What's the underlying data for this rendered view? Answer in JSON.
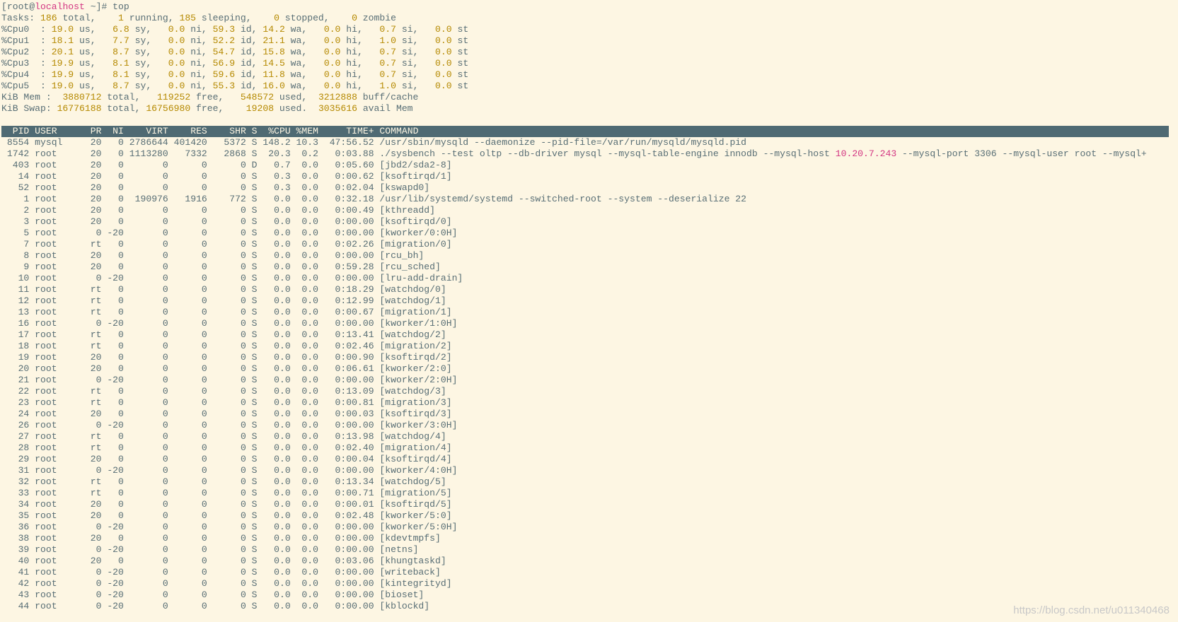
{
  "prompt": {
    "user": "root",
    "at": "@",
    "host": "localhost",
    "rest": " ~]# ",
    "command": "top",
    "open": "["
  },
  "tasks": {
    "label": "Tasks: ",
    "total": "186",
    "running": "1",
    "sleeping": "185",
    "stopped": "0",
    "zombie": "0"
  },
  "cpus": [
    {
      "name": "%Cpu0",
      "us": "19.0",
      "sy": "6.8",
      "ni": "0.0",
      "id": "59.3",
      "wa": "14.2",
      "hi": "0.0",
      "si": "0.7",
      "st": "0.0"
    },
    {
      "name": "%Cpu1",
      "us": "18.1",
      "sy": "7.7",
      "ni": "0.0",
      "id": "52.2",
      "wa": "21.1",
      "hi": "0.0",
      "si": "1.0",
      "st": "0.0"
    },
    {
      "name": "%Cpu2",
      "us": "20.1",
      "sy": "8.7",
      "ni": "0.0",
      "id": "54.7",
      "wa": "15.8",
      "hi": "0.0",
      "si": "0.7",
      "st": "0.0"
    },
    {
      "name": "%Cpu3",
      "us": "19.9",
      "sy": "8.1",
      "ni": "0.0",
      "id": "56.9",
      "wa": "14.5",
      "hi": "0.0",
      "si": "0.7",
      "st": "0.0"
    },
    {
      "name": "%Cpu4",
      "us": "19.9",
      "sy": "8.1",
      "ni": "0.0",
      "id": "59.6",
      "wa": "11.8",
      "hi": "0.0",
      "si": "0.7",
      "st": "0.0"
    },
    {
      "name": "%Cpu5",
      "us": "19.0",
      "sy": "8.7",
      "ni": "0.0",
      "id": "55.3",
      "wa": "16.0",
      "hi": "0.0",
      "si": "1.0",
      "st": "0.0"
    }
  ],
  "mem": {
    "label": "KiB Mem : ",
    "total": "3880712",
    "free": "119252",
    "used": "548572",
    "buff": "3212888"
  },
  "swap": {
    "label": "KiB Swap: ",
    "total": "16776188",
    "free": "16756980",
    "used": "19208",
    "avail": "3035616"
  },
  "columns": [
    "PID",
    "USER",
    "PR",
    "NI",
    "VIRT",
    "RES",
    "SHR",
    "S",
    "%CPU",
    "%MEM",
    "TIME+",
    "COMMAND"
  ],
  "processes": [
    {
      "pid": "8554",
      "user": "mysql",
      "pr": "20",
      "ni": "0",
      "virt": "2786644",
      "res": "401420",
      "shr": "5372",
      "s": "S",
      "cpu": "148.2",
      "mem": "10.3",
      "time": "47:56.52",
      "cmd": "/usr/sbin/mysqld --daemonize --pid-file=/var/run/mysqld/mysqld.pid"
    },
    {
      "pid": "1742",
      "user": "root",
      "pr": "20",
      "ni": "0",
      "virt": "1113280",
      "res": "7332",
      "shr": "2868",
      "s": "S",
      "cpu": "20.3",
      "mem": "0.2",
      "time": "0:03.88",
      "cmd": "./sysbench --test oltp --db-driver mysql --mysql-table-engine innodb --mysql-host ",
      "cmd_ip": "10.20.7.243",
      "cmd_tail": " --mysql-port 3306 --mysql-user root --mysql+"
    },
    {
      "pid": "403",
      "user": "root",
      "pr": "20",
      "ni": "0",
      "virt": "0",
      "res": "0",
      "shr": "0",
      "s": "D",
      "cpu": "0.7",
      "mem": "0.0",
      "time": "0:05.60",
      "cmd": "[jbd2/sda2-8]"
    },
    {
      "pid": "14",
      "user": "root",
      "pr": "20",
      "ni": "0",
      "virt": "0",
      "res": "0",
      "shr": "0",
      "s": "S",
      "cpu": "0.3",
      "mem": "0.0",
      "time": "0:00.62",
      "cmd": "[ksoftirqd/1]"
    },
    {
      "pid": "52",
      "user": "root",
      "pr": "20",
      "ni": "0",
      "virt": "0",
      "res": "0",
      "shr": "0",
      "s": "S",
      "cpu": "0.3",
      "mem": "0.0",
      "time": "0:02.04",
      "cmd": "[kswapd0]"
    },
    {
      "pid": "1",
      "user": "root",
      "pr": "20",
      "ni": "0",
      "virt": "190976",
      "res": "1916",
      "shr": "772",
      "s": "S",
      "cpu": "0.0",
      "mem": "0.0",
      "time": "0:32.18",
      "cmd": "/usr/lib/systemd/systemd --switched-root --system --deserialize 22"
    },
    {
      "pid": "2",
      "user": "root",
      "pr": "20",
      "ni": "0",
      "virt": "0",
      "res": "0",
      "shr": "0",
      "s": "S",
      "cpu": "0.0",
      "mem": "0.0",
      "time": "0:00.49",
      "cmd": "[kthreadd]"
    },
    {
      "pid": "3",
      "user": "root",
      "pr": "20",
      "ni": "0",
      "virt": "0",
      "res": "0",
      "shr": "0",
      "s": "S",
      "cpu": "0.0",
      "mem": "0.0",
      "time": "0:00.00",
      "cmd": "[ksoftirqd/0]"
    },
    {
      "pid": "5",
      "user": "root",
      "pr": "0",
      "ni": "-20",
      "virt": "0",
      "res": "0",
      "shr": "0",
      "s": "S",
      "cpu": "0.0",
      "mem": "0.0",
      "time": "0:00.00",
      "cmd": "[kworker/0:0H]"
    },
    {
      "pid": "7",
      "user": "root",
      "pr": "rt",
      "ni": "0",
      "virt": "0",
      "res": "0",
      "shr": "0",
      "s": "S",
      "cpu": "0.0",
      "mem": "0.0",
      "time": "0:02.26",
      "cmd": "[migration/0]"
    },
    {
      "pid": "8",
      "user": "root",
      "pr": "20",
      "ni": "0",
      "virt": "0",
      "res": "0",
      "shr": "0",
      "s": "S",
      "cpu": "0.0",
      "mem": "0.0",
      "time": "0:00.00",
      "cmd": "[rcu_bh]"
    },
    {
      "pid": "9",
      "user": "root",
      "pr": "20",
      "ni": "0",
      "virt": "0",
      "res": "0",
      "shr": "0",
      "s": "S",
      "cpu": "0.0",
      "mem": "0.0",
      "time": "0:59.28",
      "cmd": "[rcu_sched]"
    },
    {
      "pid": "10",
      "user": "root",
      "pr": "0",
      "ni": "-20",
      "virt": "0",
      "res": "0",
      "shr": "0",
      "s": "S",
      "cpu": "0.0",
      "mem": "0.0",
      "time": "0:00.00",
      "cmd": "[lru-add-drain]"
    },
    {
      "pid": "11",
      "user": "root",
      "pr": "rt",
      "ni": "0",
      "virt": "0",
      "res": "0",
      "shr": "0",
      "s": "S",
      "cpu": "0.0",
      "mem": "0.0",
      "time": "0:18.29",
      "cmd": "[watchdog/0]"
    },
    {
      "pid": "12",
      "user": "root",
      "pr": "rt",
      "ni": "0",
      "virt": "0",
      "res": "0",
      "shr": "0",
      "s": "S",
      "cpu": "0.0",
      "mem": "0.0",
      "time": "0:12.99",
      "cmd": "[watchdog/1]"
    },
    {
      "pid": "13",
      "user": "root",
      "pr": "rt",
      "ni": "0",
      "virt": "0",
      "res": "0",
      "shr": "0",
      "s": "S",
      "cpu": "0.0",
      "mem": "0.0",
      "time": "0:00.67",
      "cmd": "[migration/1]"
    },
    {
      "pid": "16",
      "user": "root",
      "pr": "0",
      "ni": "-20",
      "virt": "0",
      "res": "0",
      "shr": "0",
      "s": "S",
      "cpu": "0.0",
      "mem": "0.0",
      "time": "0:00.00",
      "cmd": "[kworker/1:0H]"
    },
    {
      "pid": "17",
      "user": "root",
      "pr": "rt",
      "ni": "0",
      "virt": "0",
      "res": "0",
      "shr": "0",
      "s": "S",
      "cpu": "0.0",
      "mem": "0.0",
      "time": "0:13.41",
      "cmd": "[watchdog/2]"
    },
    {
      "pid": "18",
      "user": "root",
      "pr": "rt",
      "ni": "0",
      "virt": "0",
      "res": "0",
      "shr": "0",
      "s": "S",
      "cpu": "0.0",
      "mem": "0.0",
      "time": "0:02.46",
      "cmd": "[migration/2]"
    },
    {
      "pid": "19",
      "user": "root",
      "pr": "20",
      "ni": "0",
      "virt": "0",
      "res": "0",
      "shr": "0",
      "s": "S",
      "cpu": "0.0",
      "mem": "0.0",
      "time": "0:00.90",
      "cmd": "[ksoftirqd/2]"
    },
    {
      "pid": "20",
      "user": "root",
      "pr": "20",
      "ni": "0",
      "virt": "0",
      "res": "0",
      "shr": "0",
      "s": "S",
      "cpu": "0.0",
      "mem": "0.0",
      "time": "0:06.61",
      "cmd": "[kworker/2:0]"
    },
    {
      "pid": "21",
      "user": "root",
      "pr": "0",
      "ni": "-20",
      "virt": "0",
      "res": "0",
      "shr": "0",
      "s": "S",
      "cpu": "0.0",
      "mem": "0.0",
      "time": "0:00.00",
      "cmd": "[kworker/2:0H]"
    },
    {
      "pid": "22",
      "user": "root",
      "pr": "rt",
      "ni": "0",
      "virt": "0",
      "res": "0",
      "shr": "0",
      "s": "S",
      "cpu": "0.0",
      "mem": "0.0",
      "time": "0:13.09",
      "cmd": "[watchdog/3]"
    },
    {
      "pid": "23",
      "user": "root",
      "pr": "rt",
      "ni": "0",
      "virt": "0",
      "res": "0",
      "shr": "0",
      "s": "S",
      "cpu": "0.0",
      "mem": "0.0",
      "time": "0:00.81",
      "cmd": "[migration/3]"
    },
    {
      "pid": "24",
      "user": "root",
      "pr": "20",
      "ni": "0",
      "virt": "0",
      "res": "0",
      "shr": "0",
      "s": "S",
      "cpu": "0.0",
      "mem": "0.0",
      "time": "0:00.03",
      "cmd": "[ksoftirqd/3]"
    },
    {
      "pid": "26",
      "user": "root",
      "pr": "0",
      "ni": "-20",
      "virt": "0",
      "res": "0",
      "shr": "0",
      "s": "S",
      "cpu": "0.0",
      "mem": "0.0",
      "time": "0:00.00",
      "cmd": "[kworker/3:0H]"
    },
    {
      "pid": "27",
      "user": "root",
      "pr": "rt",
      "ni": "0",
      "virt": "0",
      "res": "0",
      "shr": "0",
      "s": "S",
      "cpu": "0.0",
      "mem": "0.0",
      "time": "0:13.98",
      "cmd": "[watchdog/4]"
    },
    {
      "pid": "28",
      "user": "root",
      "pr": "rt",
      "ni": "0",
      "virt": "0",
      "res": "0",
      "shr": "0",
      "s": "S",
      "cpu": "0.0",
      "mem": "0.0",
      "time": "0:02.40",
      "cmd": "[migration/4]"
    },
    {
      "pid": "29",
      "user": "root",
      "pr": "20",
      "ni": "0",
      "virt": "0",
      "res": "0",
      "shr": "0",
      "s": "S",
      "cpu": "0.0",
      "mem": "0.0",
      "time": "0:00.04",
      "cmd": "[ksoftirqd/4]"
    },
    {
      "pid": "31",
      "user": "root",
      "pr": "0",
      "ni": "-20",
      "virt": "0",
      "res": "0",
      "shr": "0",
      "s": "S",
      "cpu": "0.0",
      "mem": "0.0",
      "time": "0:00.00",
      "cmd": "[kworker/4:0H]"
    },
    {
      "pid": "32",
      "user": "root",
      "pr": "rt",
      "ni": "0",
      "virt": "0",
      "res": "0",
      "shr": "0",
      "s": "S",
      "cpu": "0.0",
      "mem": "0.0",
      "time": "0:13.34",
      "cmd": "[watchdog/5]"
    },
    {
      "pid": "33",
      "user": "root",
      "pr": "rt",
      "ni": "0",
      "virt": "0",
      "res": "0",
      "shr": "0",
      "s": "S",
      "cpu": "0.0",
      "mem": "0.0",
      "time": "0:00.71",
      "cmd": "[migration/5]"
    },
    {
      "pid": "34",
      "user": "root",
      "pr": "20",
      "ni": "0",
      "virt": "0",
      "res": "0",
      "shr": "0",
      "s": "S",
      "cpu": "0.0",
      "mem": "0.0",
      "time": "0:00.01",
      "cmd": "[ksoftirqd/5]"
    },
    {
      "pid": "35",
      "user": "root",
      "pr": "20",
      "ni": "0",
      "virt": "0",
      "res": "0",
      "shr": "0",
      "s": "S",
      "cpu": "0.0",
      "mem": "0.0",
      "time": "0:02.48",
      "cmd": "[kworker/5:0]"
    },
    {
      "pid": "36",
      "user": "root",
      "pr": "0",
      "ni": "-20",
      "virt": "0",
      "res": "0",
      "shr": "0",
      "s": "S",
      "cpu": "0.0",
      "mem": "0.0",
      "time": "0:00.00",
      "cmd": "[kworker/5:0H]"
    },
    {
      "pid": "38",
      "user": "root",
      "pr": "20",
      "ni": "0",
      "virt": "0",
      "res": "0",
      "shr": "0",
      "s": "S",
      "cpu": "0.0",
      "mem": "0.0",
      "time": "0:00.00",
      "cmd": "[kdevtmpfs]"
    },
    {
      "pid": "39",
      "user": "root",
      "pr": "0",
      "ni": "-20",
      "virt": "0",
      "res": "0",
      "shr": "0",
      "s": "S",
      "cpu": "0.0",
      "mem": "0.0",
      "time": "0:00.00",
      "cmd": "[netns]"
    },
    {
      "pid": "40",
      "user": "root",
      "pr": "20",
      "ni": "0",
      "virt": "0",
      "res": "0",
      "shr": "0",
      "s": "S",
      "cpu": "0.0",
      "mem": "0.0",
      "time": "0:03.06",
      "cmd": "[khungtaskd]"
    },
    {
      "pid": "41",
      "user": "root",
      "pr": "0",
      "ni": "-20",
      "virt": "0",
      "res": "0",
      "shr": "0",
      "s": "S",
      "cpu": "0.0",
      "mem": "0.0",
      "time": "0:00.00",
      "cmd": "[writeback]"
    },
    {
      "pid": "42",
      "user": "root",
      "pr": "0",
      "ni": "-20",
      "virt": "0",
      "res": "0",
      "shr": "0",
      "s": "S",
      "cpu": "0.0",
      "mem": "0.0",
      "time": "0:00.00",
      "cmd": "[kintegrityd]"
    },
    {
      "pid": "43",
      "user": "root",
      "pr": "0",
      "ni": "-20",
      "virt": "0",
      "res": "0",
      "shr": "0",
      "s": "S",
      "cpu": "0.0",
      "mem": "0.0",
      "time": "0:00.00",
      "cmd": "[bioset]"
    },
    {
      "pid": "44",
      "user": "root",
      "pr": "0",
      "ni": "-20",
      "virt": "0",
      "res": "0",
      "shr": "0",
      "s": "S",
      "cpu": "0.0",
      "mem": "0.0",
      "time": "0:00.00",
      "cmd": "[kblockd]"
    }
  ],
  "watermark": "https://blog.csdn.net/u011340468",
  "colors": {
    "background": "#fdf6e3",
    "text": "#586e75",
    "highlight": "#b58900",
    "accent": "#d33682",
    "header_bg": "#4f6a73"
  }
}
